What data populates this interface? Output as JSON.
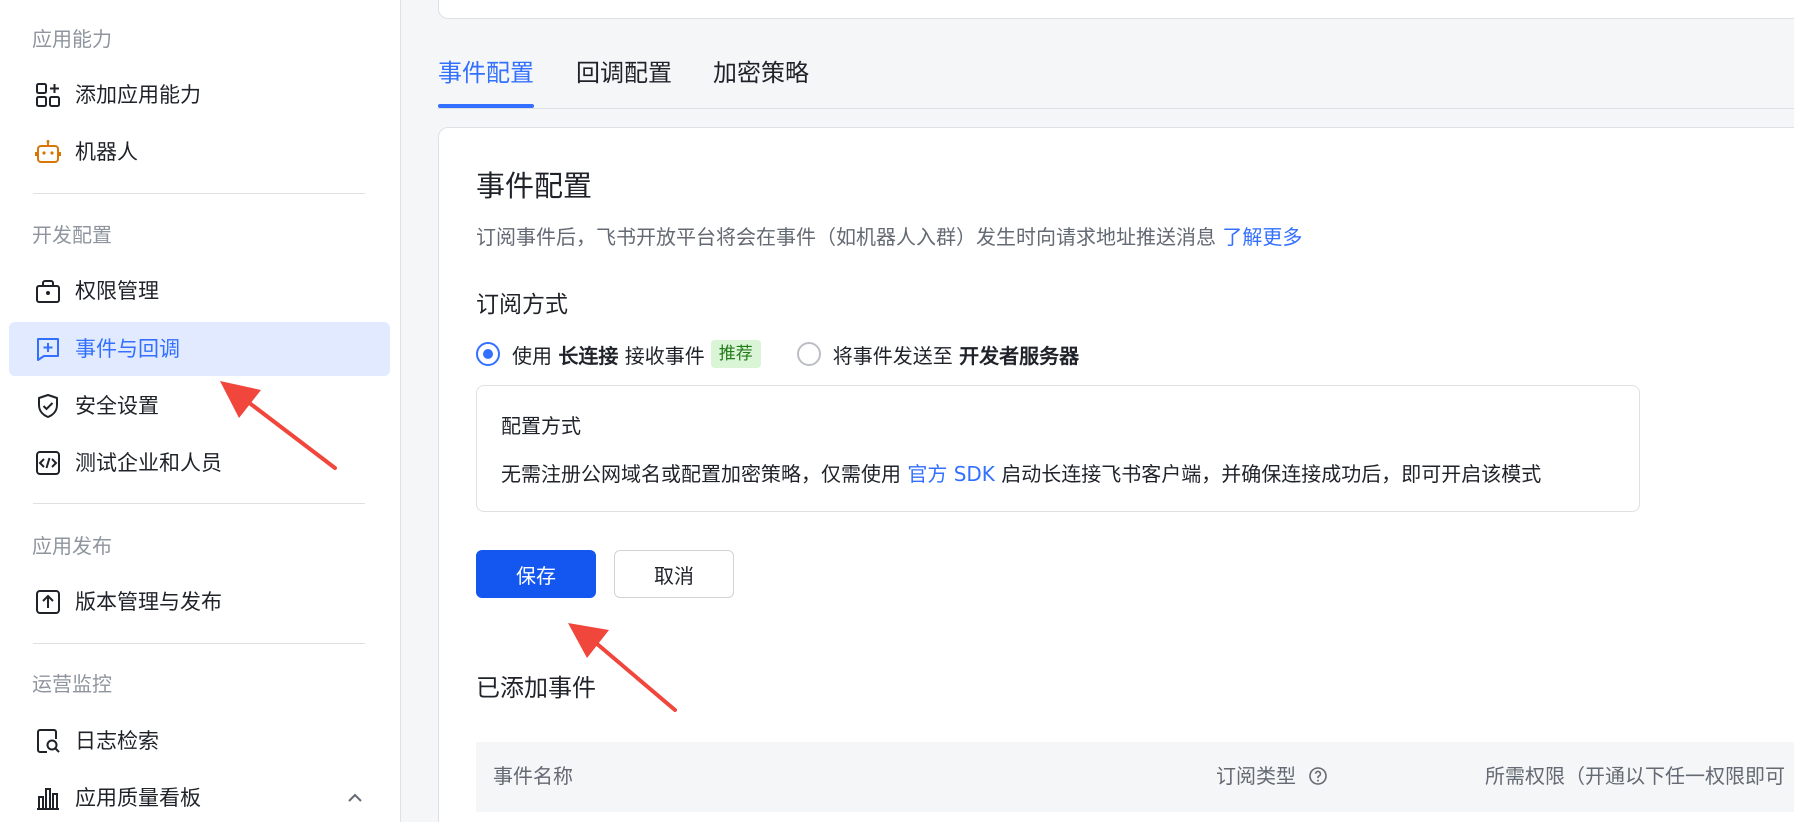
{
  "sidebar": {
    "sections": [
      {
        "title": "应用能力"
      },
      {
        "title": "开发配置"
      },
      {
        "title": "应用发布"
      },
      {
        "title": "运营监控"
      }
    ],
    "items": [
      {
        "label": "添加应用能力",
        "icon": "add-capability-icon"
      },
      {
        "label": "机器人",
        "icon": "robot-icon"
      },
      {
        "label": "权限管理",
        "icon": "permission-lock-icon"
      },
      {
        "label": "事件与回调",
        "icon": "event-callback-icon",
        "active": true
      },
      {
        "label": "安全设置",
        "icon": "shield-check-icon"
      },
      {
        "label": "测试企业和人员",
        "icon": "code-test-icon"
      },
      {
        "label": "版本管理与发布",
        "icon": "upload-icon"
      },
      {
        "label": "日志检索",
        "icon": "log-search-icon"
      },
      {
        "label": "应用质量看板",
        "icon": "bar-chart-icon"
      }
    ]
  },
  "tabs": [
    {
      "label": "事件配置",
      "active": true
    },
    {
      "label": "回调配置"
    },
    {
      "label": "加密策略"
    }
  ],
  "panel": {
    "title": "事件配置",
    "description": "订阅事件后，飞书开放平台将会在事件（如机器人入群）发生时向请求地址推送消息",
    "learn_more": "了解更多",
    "subscribe_title": "订阅方式",
    "option1": {
      "prefix": "使用",
      "bold": "长连接",
      "suffix": "接收事件",
      "tag": "推荐",
      "checked": true
    },
    "option2": {
      "prefix": "将事件发送至",
      "bold": "开发者服务器",
      "checked": false
    },
    "info": {
      "title": "配置方式",
      "text_before": "无需注册公网域名或配置加密策略，仅需使用",
      "link": "官方 SDK",
      "text_after": "启动长连接飞书客户端，并确保连接成功后，即可开启该模式"
    },
    "save_label": "保存",
    "cancel_label": "取消",
    "added_title": "已添加事件",
    "table_headers": {
      "name": "事件名称",
      "type": "订阅类型",
      "permission": "所需权限（开通以下任一权限即可"
    }
  },
  "colors": {
    "accent": "#3370ff",
    "primary_button": "#1456f0",
    "annotation_arrow": "#f0463c"
  }
}
